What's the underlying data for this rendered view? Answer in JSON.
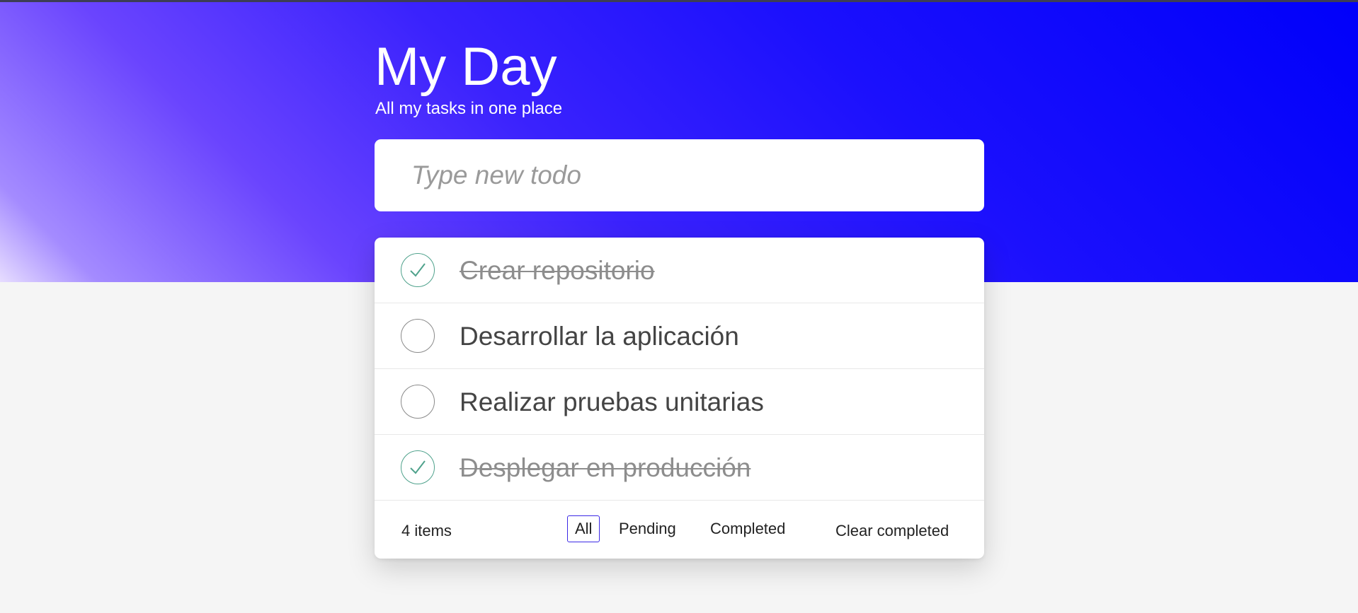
{
  "header": {
    "title": "My Day",
    "subtitle": "All my tasks in one place"
  },
  "new_todo": {
    "placeholder": "Type new todo",
    "value": ""
  },
  "todos": [
    {
      "text": "Crear repositorio",
      "completed": true
    },
    {
      "text": "Desarrollar la aplicación",
      "completed": false
    },
    {
      "text": "Realizar pruebas unitarias",
      "completed": false
    },
    {
      "text": "Desplegar en producción",
      "completed": true
    }
  ],
  "footer": {
    "count_label": "4 items",
    "filters": [
      {
        "label": "All",
        "active": true
      },
      {
        "label": "Pending",
        "active": false
      },
      {
        "label": "Completed",
        "active": false
      }
    ],
    "clear_label": "Clear completed"
  },
  "colors": {
    "accent": "#0000fa",
    "check_done": "#4fa28c",
    "active_filter_border": "#3b28e6"
  },
  "icons": {
    "checkmark": "check-icon"
  }
}
